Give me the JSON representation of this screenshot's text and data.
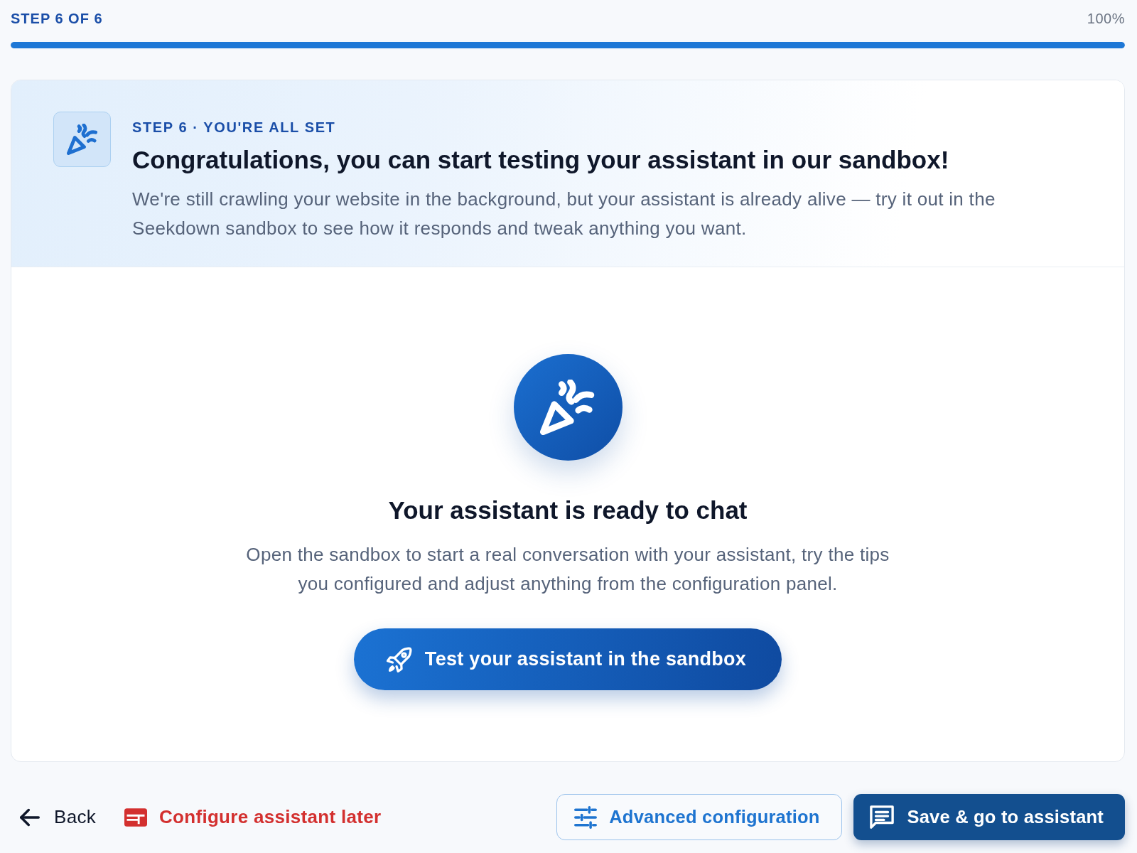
{
  "progress": {
    "label": "STEP 6 OF 6",
    "reading": "100%",
    "level": 1
  },
  "hero": {
    "eyebrow": "STEP 6 · YOU'RE ALL SET",
    "title": "Congratulations, you can start testing your assistant in our sandbox!",
    "text": "We're still crawling your website in the background, but your assistant is already alive — try it out in the Seekdown sandbox to see how it responds and tweak anything you want."
  },
  "ready": {
    "title": "Your assistant is ready to chat",
    "text": "Open the sandbox to start a real conversation with your assistant, try the tips you configured and adjust anything from the configuration panel.",
    "button": "Test your assistant in the sandbox"
  },
  "actions": [
    {
      "kind": "back",
      "label": "Back"
    },
    {
      "kind": "later",
      "label": "Configure assistant later"
    },
    {
      "kind": "outline",
      "label": "Advanced configuration"
    },
    {
      "kind": "primary",
      "label": "Save & go to assistant"
    }
  ]
}
